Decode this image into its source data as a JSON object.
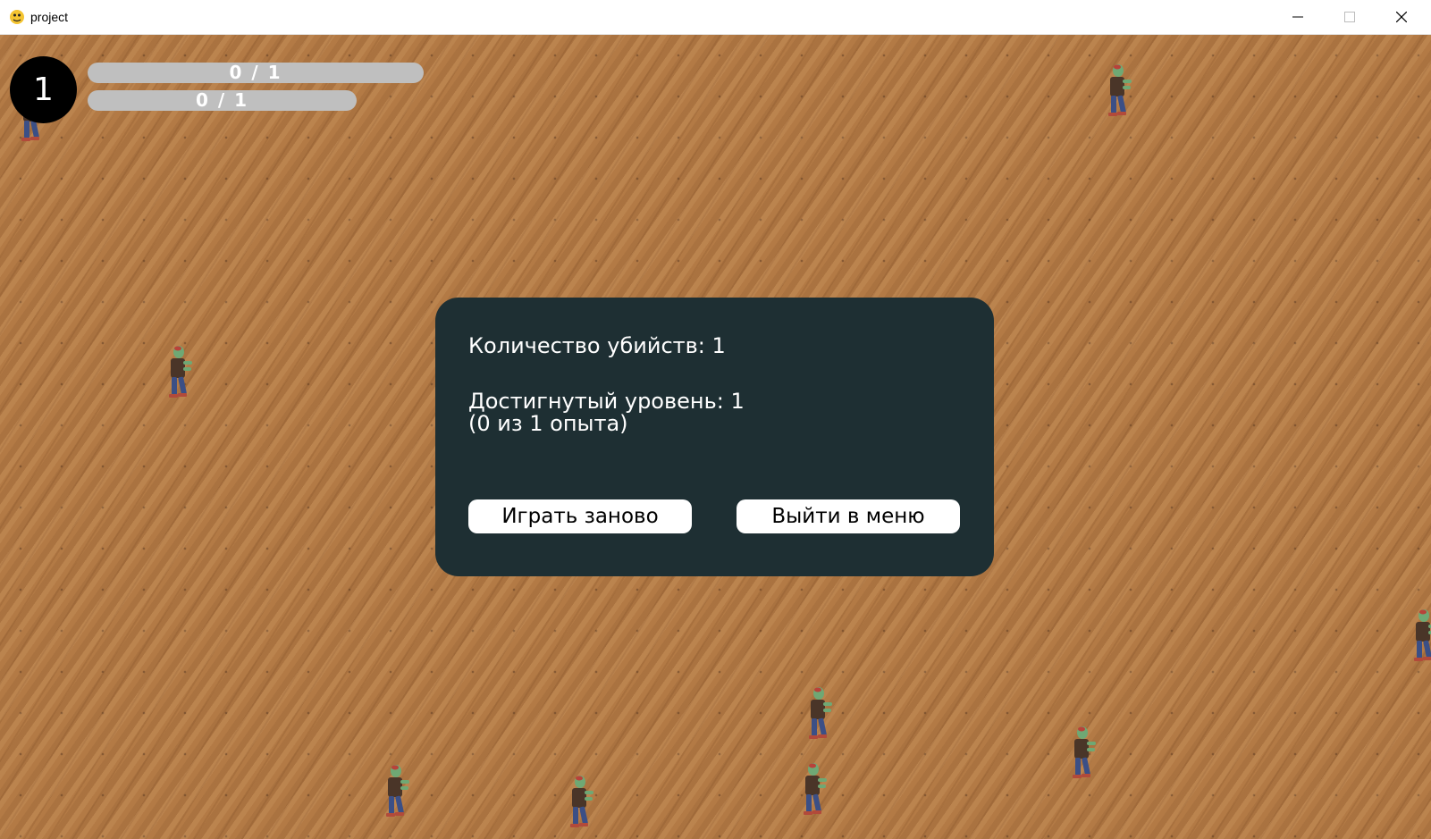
{
  "window": {
    "title": "project",
    "icon": "python-snake-icon",
    "controls": [
      "minimize-icon",
      "maximize-icon",
      "close-icon"
    ]
  },
  "hud": {
    "level": "1",
    "bar_top_label": "0 / 1",
    "bar_bottom_label": "0 / 1",
    "bar_top_progress": 0,
    "bar_bottom_progress": 0
  },
  "dialog": {
    "kills_line": "Количество убийств: 1",
    "level_line": "Достигнутый уровень: 1",
    "experience_line": "(0 из 1 опыта)",
    "restart_label": "Играть заново",
    "menu_label": "Выйти в меню"
  },
  "colors": {
    "ground": "#b37a45",
    "dialog_background": "#1e2f33",
    "bar_background": "#bfbfbf",
    "level_badge": "#000000",
    "button_background": "#ffffff"
  },
  "sprites": {
    "zombie_count": 11,
    "zombie_icon": "zombie-sprite"
  }
}
